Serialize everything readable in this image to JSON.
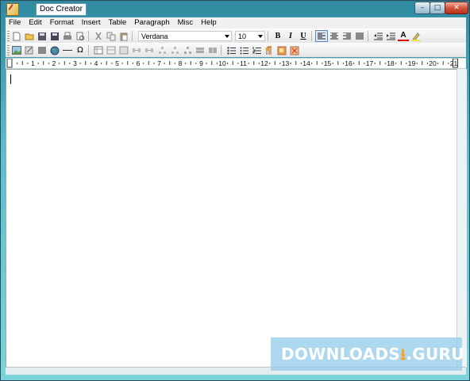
{
  "window": {
    "title": "Doc Creator",
    "controls": {
      "minimize": "–",
      "maximize": "□",
      "close": "✕"
    }
  },
  "menu": [
    "File",
    "Edit",
    "Format",
    "Insert",
    "Table",
    "Paragraph",
    "Misc",
    "Help"
  ],
  "toolbar1": {
    "font_family": "Verdana",
    "font_size": "10",
    "bold": "B",
    "italic": "I",
    "underline": "U",
    "font_color_glyph": "A",
    "icons": [
      "new-document-icon",
      "open-folder-icon",
      "save-icon",
      "save-as-icon",
      "print-icon",
      "print-preview-icon",
      "cut-icon",
      "copy-icon",
      "paste-icon",
      "align-left-icon",
      "align-center-icon",
      "align-right-icon",
      "justify-icon",
      "decrease-indent-icon",
      "increase-indent-icon",
      "font-color-icon",
      "highlight-icon"
    ]
  },
  "toolbar2": {
    "symbol_glyph": "Ω",
    "icons": [
      "insert-image-icon",
      "insert-link-icon",
      "insert-table-icon",
      "insert-globe-icon",
      "insert-line-icon",
      "insert-symbol-icon",
      "table-props-icon",
      "insert-row-icon",
      "delete-row-icon",
      "insert-col-icon",
      "delete-col-icon",
      "insert-col-left-icon",
      "insert-col-right-icon",
      "split-cell-icon",
      "merge-cell-icon",
      "cell-props-icon",
      "list-bullets-icon",
      "list-numbers-icon",
      "list-ordered-icon",
      "paragraph-icon",
      "background-icon",
      "page-icon"
    ]
  },
  "ruler": {
    "numbers": [
      "1",
      "2",
      "3",
      "4",
      "5",
      "6",
      "7",
      "8",
      "9",
      "10",
      "11",
      "12",
      "13",
      "14",
      "15",
      "16",
      "17",
      "18",
      "19",
      "20",
      "21"
    ]
  },
  "watermark": {
    "text_left": "DOWNLOADS",
    "icon": "download-arrow-icon",
    "text_right": ".GURU"
  }
}
